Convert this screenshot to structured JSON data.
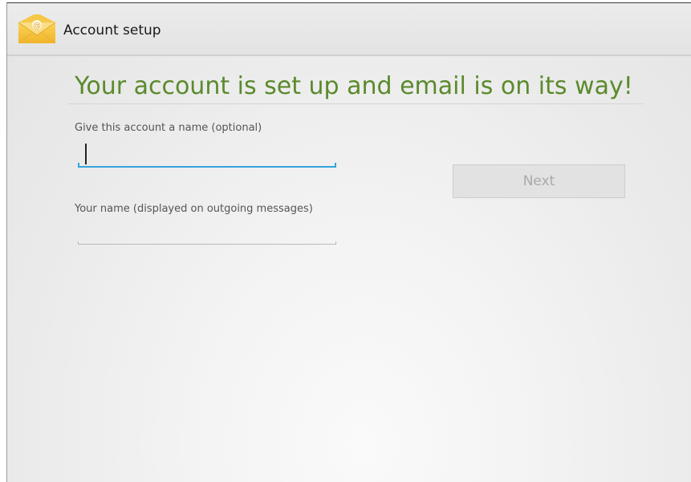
{
  "app": {
    "title": "Account setup",
    "icon": "email-app-icon"
  },
  "main": {
    "headline": "Your account is set up and email is on its way!",
    "account_name_label": "Give this account a name (optional)",
    "account_name_value": "",
    "your_name_label": "Your name (displayed on outgoing messages)",
    "your_name_value": "",
    "next_label": "Next"
  },
  "colors": {
    "headline": "#5b8a2c",
    "focus_underline": "#33a4da",
    "button_disabled_text": "#a9a9a9"
  }
}
